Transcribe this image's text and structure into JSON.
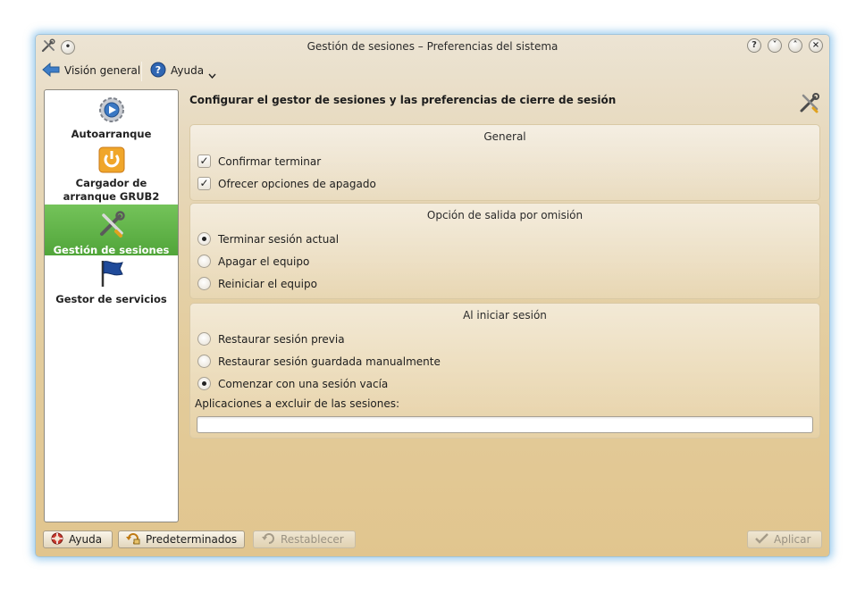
{
  "window": {
    "title": "Gestión de sesiones – Preferencias del sistema"
  },
  "toolbar": {
    "overview_label": "Visión general",
    "help_label": "Ayuda"
  },
  "sidebar": {
    "items": [
      {
        "label_line1": "Autoarranque",
        "label_line2": "",
        "icon": "gear-play-icon",
        "selected": false
      },
      {
        "label_line1": "Cargador de",
        "label_line2": "arranque GRUB2",
        "icon": "grub-boot-icon",
        "selected": false
      },
      {
        "label_line1": "Gestión de sesiones",
        "label_line2": "",
        "icon": "tools-icon",
        "selected": true
      },
      {
        "label_line1": "Gestor de servicios",
        "label_line2": "",
        "icon": "flag-icon",
        "selected": false
      }
    ]
  },
  "main": {
    "header": "Configurar el gestor de sesiones y las preferencias de cierre de sesión",
    "general": {
      "title": "General",
      "confirm_logout": {
        "label": "Confirmar terminar",
        "checked": true
      },
      "offer_shutdown": {
        "label": "Ofrecer opciones de apagado",
        "checked": true
      }
    },
    "default_leave": {
      "title": "Opción de salida por omisión",
      "options": [
        {
          "label": "Terminar sesión actual",
          "selected": true
        },
        {
          "label": "Apagar el equipo",
          "selected": false
        },
        {
          "label": "Reiniciar el equipo",
          "selected": false
        }
      ]
    },
    "on_login": {
      "title": "Al iniciar sesión",
      "options": [
        {
          "label": "Restaurar sesión previa",
          "selected": false
        },
        {
          "label": "Restaurar sesión guardada manualmente",
          "selected": false
        },
        {
          "label": "Comenzar con una sesión vacía",
          "selected": true
        }
      ],
      "exclude_label": "Aplicaciones a excluir de las sesiones:",
      "exclude_value": ""
    }
  },
  "buttons": {
    "help": "Ayuda",
    "defaults": "Predeterminados",
    "reset": "Restablecer",
    "apply": "Aplicar"
  },
  "colors": {
    "selection": "#5aae42",
    "window_glow": "#5aaae1"
  }
}
